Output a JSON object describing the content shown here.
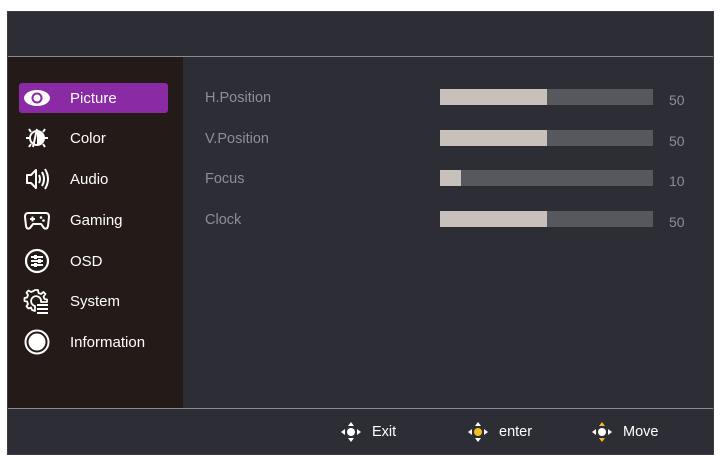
{
  "menu": [
    {
      "label": "Picture",
      "icon": "eye-icon",
      "active": true
    },
    {
      "label": "Color",
      "icon": "color-icon",
      "active": false
    },
    {
      "label": "Audio",
      "icon": "speaker-icon",
      "active": false
    },
    {
      "label": "Gaming",
      "icon": "gamepad-icon",
      "active": false
    },
    {
      "label": "OSD",
      "icon": "osd-sliders-icon",
      "active": false
    },
    {
      "label": "System",
      "icon": "system-gear-icon",
      "active": false
    },
    {
      "label": "Information",
      "icon": "information-circle-icon",
      "active": false
    }
  ],
  "settings": [
    {
      "label": "H.Position",
      "value": "50",
      "level": 50
    },
    {
      "label": "V.Position",
      "value": "50",
      "level": 50
    },
    {
      "label": "Focus",
      "value": "10",
      "level": 10
    },
    {
      "label": "Clock",
      "value": "50",
      "level": 50
    }
  ],
  "footer": {
    "exit_label": "Exit",
    "enter_label": "enter",
    "move_label": "Move"
  },
  "colors": {
    "accent": "#8a2aa4",
    "highlight": "#f0c020"
  }
}
